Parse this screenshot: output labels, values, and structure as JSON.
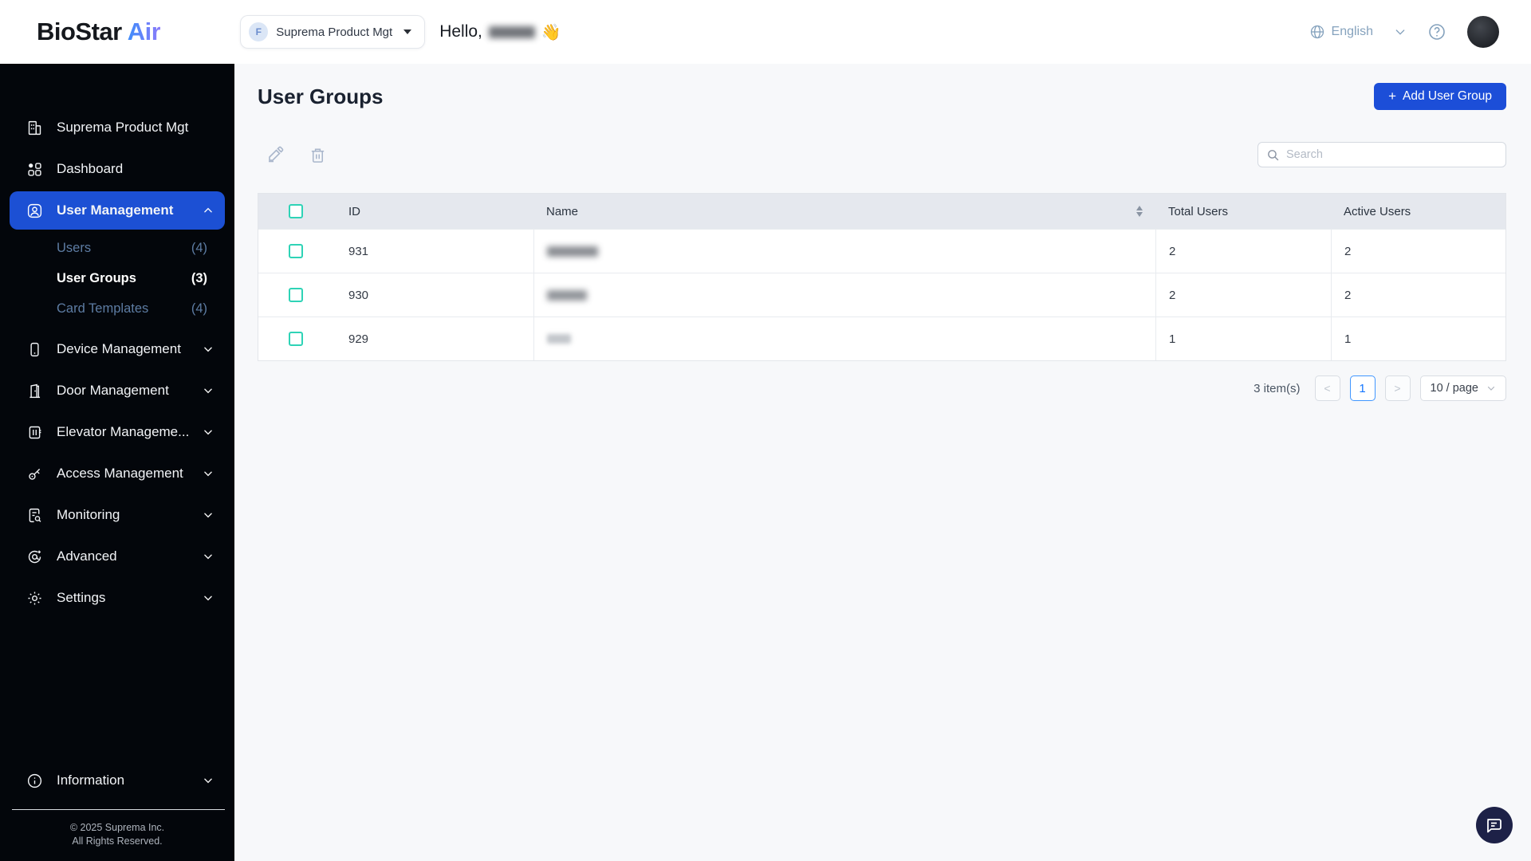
{
  "header": {
    "logo_part1": "BioStar",
    "logo_part2": "Air",
    "org_selector": {
      "badge": "F",
      "label": "Suprema Product Mgt"
    },
    "greeting_prefix": "Hello,",
    "greeting_emoji": "👋",
    "language": "English"
  },
  "sidebar": {
    "items": [
      {
        "label": "Suprema Product Mgt"
      },
      {
        "label": "Dashboard"
      },
      {
        "label": "User Management"
      },
      {
        "label": "Device Management"
      },
      {
        "label": "Door Management"
      },
      {
        "label": "Elevator Manageme..."
      },
      {
        "label": "Access Management"
      },
      {
        "label": "Monitoring"
      },
      {
        "label": "Advanced"
      },
      {
        "label": "Settings"
      },
      {
        "label": "Information"
      }
    ],
    "submenu": [
      {
        "label": "Users",
        "count": "(4)"
      },
      {
        "label": "User Groups",
        "count": "(3)"
      },
      {
        "label": "Card Templates",
        "count": "(4)"
      }
    ],
    "copyright_line1": "© 2025 Suprema Inc.",
    "copyright_line2": "All Rights Reserved."
  },
  "main": {
    "title": "User Groups",
    "add_button": "Add User Group",
    "add_button_plus": "+",
    "search_placeholder": "Search",
    "table": {
      "columns": {
        "id": "ID",
        "name": "Name",
        "total": "Total Users",
        "active": "Active Users"
      },
      "rows": [
        {
          "id": "931",
          "total_users": "2",
          "active_users": "2"
        },
        {
          "id": "930",
          "total_users": "2",
          "active_users": "2"
        },
        {
          "id": "929",
          "total_users": "1",
          "active_users": "1"
        }
      ]
    },
    "pagination": {
      "items_count": "3 item(s)",
      "prev": "<",
      "current_page": "1",
      "next": ">",
      "page_size": "10 / page"
    }
  },
  "colors": {
    "sidebar_active": "#1c50d4",
    "primary_button": "#1c4ed8",
    "checkbox_accent": "#2ed3b6",
    "pagination_accent": "#1677ff",
    "header_muted": "#85a2bd"
  }
}
